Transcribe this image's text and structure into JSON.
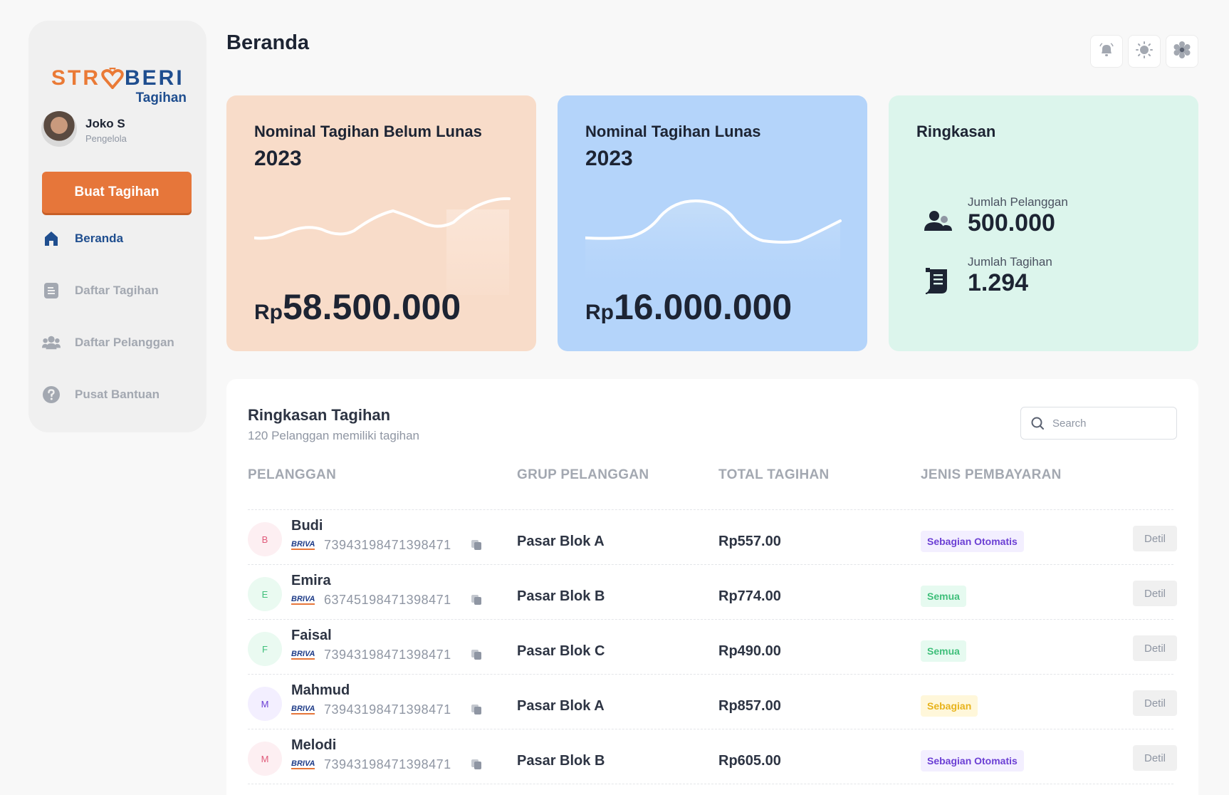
{
  "brand": {
    "logo_prefix": "STR",
    "logo_suffix": "BERI",
    "logo_sub": "Tagihan",
    "orange": "#ea7a36",
    "blue": "#1f4e8f"
  },
  "user": {
    "name": "Joko S",
    "role": "Pengelola"
  },
  "sidebar": {
    "create_button": "Buat Tagihan",
    "items": [
      {
        "label": "Beranda",
        "icon": "home-icon",
        "active": true
      },
      {
        "label": "Daftar Tagihan",
        "icon": "document-icon",
        "active": false
      },
      {
        "label": "Daftar Pelanggan",
        "icon": "users-icon",
        "active": false
      },
      {
        "label": "Pusat Bantuan",
        "icon": "help-icon",
        "active": false
      }
    ]
  },
  "header": {
    "title": "Beranda",
    "buttons": [
      "bell-icon",
      "sun-icon",
      "gear-icon"
    ]
  },
  "cards": {
    "unpaid": {
      "title": "Nominal Tagihan Belum Lunas",
      "year": "2023",
      "currency": "Rp",
      "amount": "58.500.000",
      "color": "#f8dcc9"
    },
    "paid": {
      "title": "Nominal Tagihan Lunas",
      "year": "2023",
      "currency": "Rp",
      "amount": "16.000.000",
      "color": "#b4d4fa"
    },
    "summary": {
      "title": "Ringkasan",
      "color": "#dcf5ec",
      "customers_label": "Jumlah Pelanggan",
      "customers_value": "500.000",
      "bills_label": "Jumlah Tagihan",
      "bills_value": "1.294"
    }
  },
  "table": {
    "title": "Ringkasan Tagihan",
    "subtitle": "120 Pelanggan memiliki tagihan",
    "search_placeholder": "Search",
    "columns": [
      "PELANGGAN",
      "GRUP PELANGGAN",
      "TOTAL TAGIHAN",
      "JENIS PEMBAYARAN"
    ],
    "rows": [
      {
        "initial": "B",
        "name": "Budi",
        "bank": "BRIVA",
        "va": "73943198471398471",
        "group": "Pasar Blok A",
        "total": "Rp557.00",
        "type": "Sebagian Otomatis",
        "action": "Detil"
      },
      {
        "initial": "E",
        "name": "Emira",
        "bank": "BRIVA",
        "va": "63745198471398471",
        "group": "Pasar Blok B",
        "total": "Rp774.00",
        "type": "Semua",
        "action": "Detil"
      },
      {
        "initial": "F",
        "name": "Faisal",
        "bank": "BRIVA",
        "va": "73943198471398471",
        "group": "Pasar Blok C",
        "total": "Rp490.00",
        "type": "Semua",
        "action": "Detil"
      },
      {
        "initial": "M",
        "name": "Mahmud",
        "bank": "BRIVA",
        "va": "73943198471398471",
        "group": "Pasar Blok A",
        "total": "Rp857.00",
        "type": "Sebagian",
        "action": "Detil"
      },
      {
        "initial": "M",
        "name": "Melodi",
        "bank": "BRIVA",
        "va": "73943198471398471",
        "group": "Pasar Blok B",
        "total": "Rp605.00",
        "type": "Sebagian Otomatis",
        "action": "Detil"
      }
    ]
  }
}
